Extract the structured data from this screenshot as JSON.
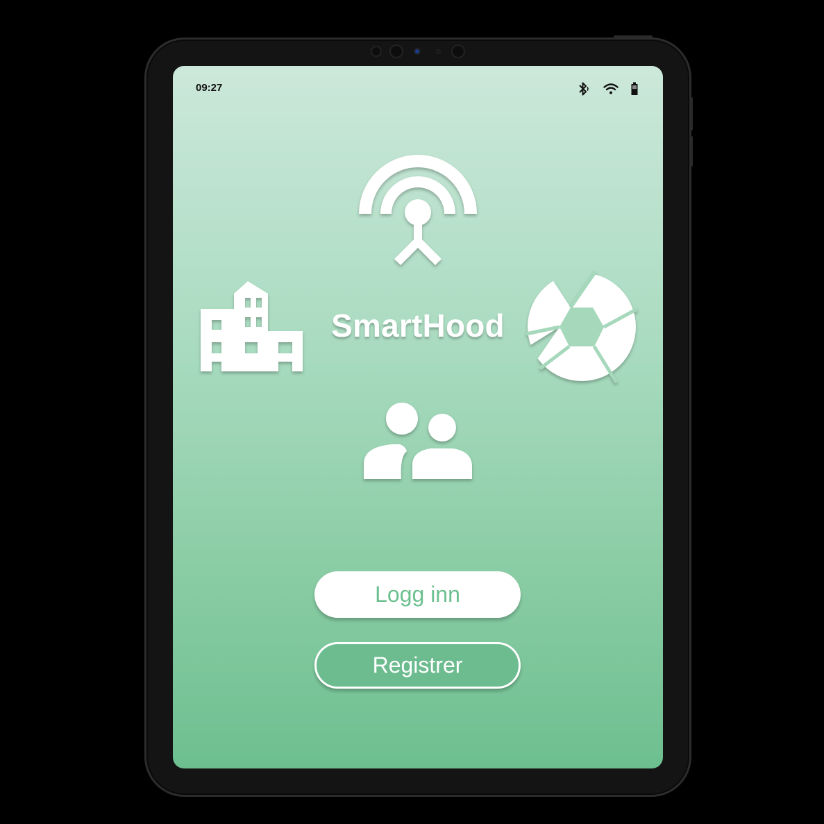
{
  "status_bar": {
    "time": "09:27",
    "icons": [
      "bluetooth-icon",
      "wifi-icon",
      "battery-icon"
    ]
  },
  "app": {
    "title": "SmartHood"
  },
  "icons": [
    "antenna-icon",
    "building-icon",
    "camera-shutter-icon",
    "people-icon"
  ],
  "buttons": {
    "login_label": "Logg inn",
    "register_label": "Registrer"
  },
  "colors": {
    "accent": "#6cc08f",
    "gradient_top": "#cce8da",
    "gradient_bottom": "#6dbf90",
    "device_frame": "#141414"
  }
}
